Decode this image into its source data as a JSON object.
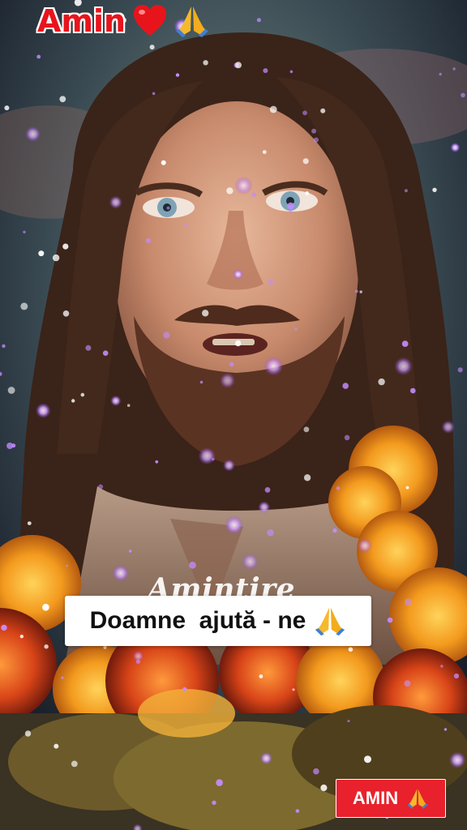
{
  "header": {
    "title": "Amin"
  },
  "icons": {
    "heart": "heart-icon",
    "hands": "praying-hands-icon"
  },
  "watermark": {
    "text": "Amintire"
  },
  "caption": {
    "text": "Doamne  ajută - ne"
  },
  "button": {
    "label": "AMIN"
  },
  "colors": {
    "title_red": "#e8141c",
    "button_red": "#e8212c",
    "sparkle": "#b36cff"
  }
}
